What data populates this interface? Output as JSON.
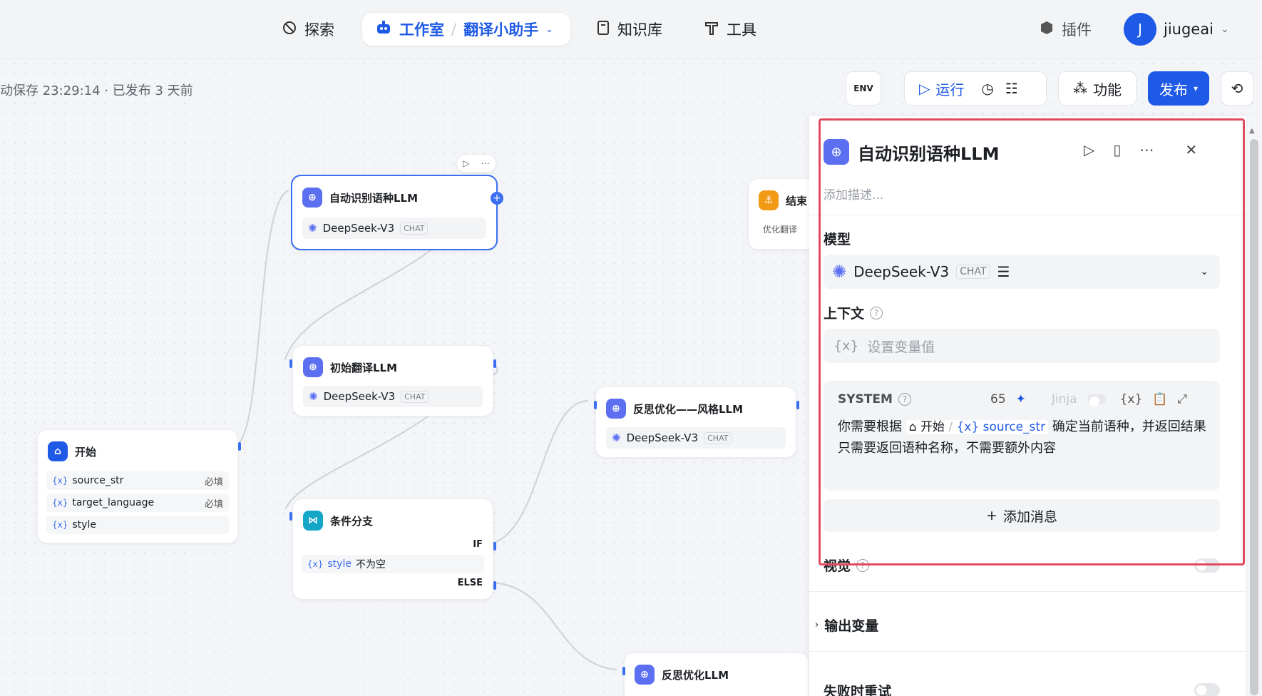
{
  "nav": {
    "explore": "探索",
    "studio": "工作室",
    "app_name": "翻译小助手",
    "knowledge": "知识库",
    "tools": "工具",
    "plugins": "插件",
    "avatar_letter": "J",
    "username": "jiugeai"
  },
  "toolbar": {
    "save_status": "动保存 23:29:14 · 已发布 3 天前",
    "env": "ENV",
    "run": "运行",
    "features": "功能",
    "publish": "发布"
  },
  "nodes": {
    "auto_detect": {
      "title": "自动识别语种LLM",
      "model": "DeepSeek-V3",
      "tag": "CHAT"
    },
    "initial_translate": {
      "title": "初始翻译LLM",
      "model": "DeepSeek-V3",
      "tag": "CHAT"
    },
    "reflect_style": {
      "title": "反思优化——风格LLM",
      "model": "DeepSeek-V3",
      "tag": "CHAT"
    },
    "reflect": {
      "title": "反思优化LLM"
    },
    "end": {
      "title": "结束",
      "output": "优化翻译"
    },
    "start": {
      "title": "开始",
      "vars": [
        {
          "name": "source_str",
          "req": "必填"
        },
        {
          "name": "target_language",
          "req": "必填"
        },
        {
          "name": "style",
          "req": ""
        }
      ]
    },
    "branch": {
      "title": "条件分支",
      "if": "IF",
      "else": "ELSE",
      "cond_var": "style",
      "cond_op": "不为空"
    }
  },
  "panel": {
    "title": "自动识别语种LLM",
    "desc_placeholder": "添加描述...",
    "model_label": "模型",
    "model_name": "DeepSeek-V3",
    "model_tag": "CHAT",
    "context_label": "上下文",
    "context_placeholder": "设置变量值",
    "system_label": "SYSTEM",
    "token_count": "65",
    "jinja": "Jinja",
    "prompt_pre": "你需要根据",
    "ref_node": "开始",
    "ref_var": "source_str",
    "prompt_post": "确定当前语种，并返回结果",
    "prompt_line2": "只需要返回语种名称，不需要额外内容",
    "add_message": "添加消息",
    "vision_label": "视觉",
    "output_label": "输出变量",
    "retry_label": "失败时重试"
  }
}
